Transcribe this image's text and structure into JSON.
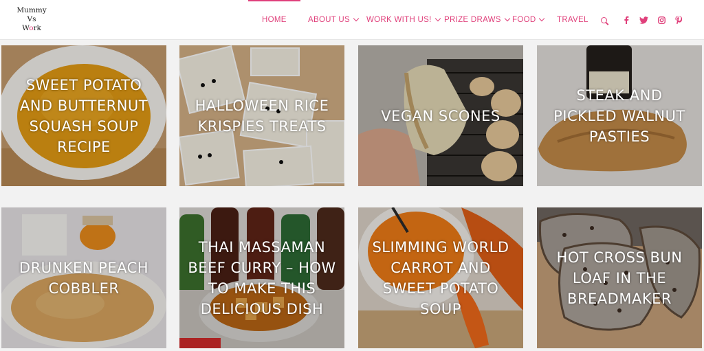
{
  "logo": {
    "line1": "Mummy",
    "line2": "Vs",
    "line3_a": "W",
    "line3_b": "o",
    "line3_c": "rk"
  },
  "nav": {
    "home": "HOME",
    "about": "ABOUT US",
    "work": "WORK WITH US!",
    "prize": "PRIZE DRAWS",
    "food": "FOOD",
    "travel": "TRAVEL"
  },
  "icons": [
    "search-icon",
    "facebook-icon",
    "twitter-icon",
    "instagram-icon",
    "pinterest-icon"
  ],
  "colors": {
    "accent": "#e0407b"
  },
  "posts": [
    {
      "title": "SWEET POTATO AND BUTTERNUT SQUASH SOUP RECIPE"
    },
    {
      "title": "HALLOWEEN RICE KRISPIES TREATS"
    },
    {
      "title": "VEGAN SCONES"
    },
    {
      "title": "STEAK AND PICKLED WALNUT PASTIES"
    },
    {
      "title": "DRUNKEN PEACH COBBLER"
    },
    {
      "title": "THAI MASSAMAN BEEF CURRY – HOW TO MAKE THIS DELICIOUS DISH"
    },
    {
      "title": "SLIMMING WORLD CARROT AND SWEET POTATO SOUP"
    },
    {
      "title": "HOT CROSS BUN LOAF IN THE BREADMAKER"
    }
  ]
}
